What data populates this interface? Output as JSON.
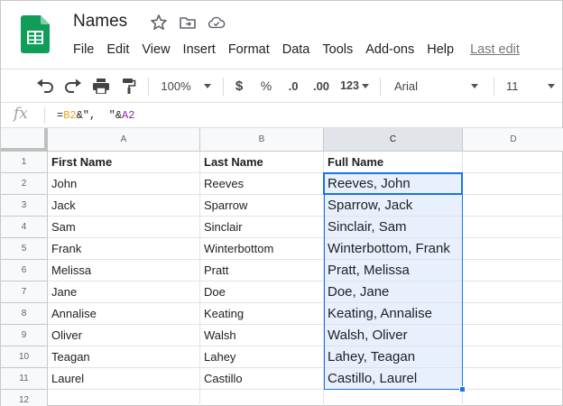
{
  "app": {
    "title": "Names",
    "brand_color": "#0f9d58",
    "icons": [
      "star-icon",
      "move-to-folder-icon",
      "cloud-saved-icon"
    ]
  },
  "menu": [
    "File",
    "Edit",
    "View",
    "Insert",
    "Format",
    "Data",
    "Tools",
    "Add-ons",
    "Help"
  ],
  "last_edit": "Last edit",
  "toolbar": {
    "zoom": "100%",
    "currency": "$",
    "percent": "%",
    "decrease_decimal": ".0",
    "increase_decimal": ".00",
    "more_formats": "123",
    "font": "Arial",
    "font_size": "11"
  },
  "formula_bar": {
    "fx_label": "fx",
    "formula_prefix": "=",
    "ref1": "B2",
    "middle": "&\",  \"&",
    "ref2": "A2"
  },
  "grid": {
    "columns": [
      "A",
      "B",
      "C",
      "D"
    ],
    "row_numbers": [
      "1",
      "2",
      "3",
      "4",
      "5",
      "6",
      "7",
      "8",
      "9",
      "10",
      "11",
      "12"
    ],
    "headers": [
      "First Name",
      "Last Name",
      "Full Name"
    ],
    "rows": [
      [
        "John",
        "Reeves",
        "Reeves, John"
      ],
      [
        "Jack",
        "Sparrow",
        "Sparrow, Jack"
      ],
      [
        "Sam",
        "Sinclair",
        "Sinclair, Sam"
      ],
      [
        "Frank",
        "Winterbottom",
        "Winterbottom, Frank"
      ],
      [
        "Melissa",
        "Pratt",
        "Pratt, Melissa"
      ],
      [
        "Jane",
        "Doe",
        "Doe, Jane"
      ],
      [
        "Annalise",
        "Keating",
        "Keating, Annalise"
      ],
      [
        "Oliver",
        "Walsh",
        "Walsh, Oliver"
      ],
      [
        "Teagan",
        "Lahey",
        "Lahey, Teagan"
      ],
      [
        "Laurel",
        "Castillo",
        "Castillo, Laurel"
      ]
    ],
    "selection_color": "#1a73e8"
  }
}
